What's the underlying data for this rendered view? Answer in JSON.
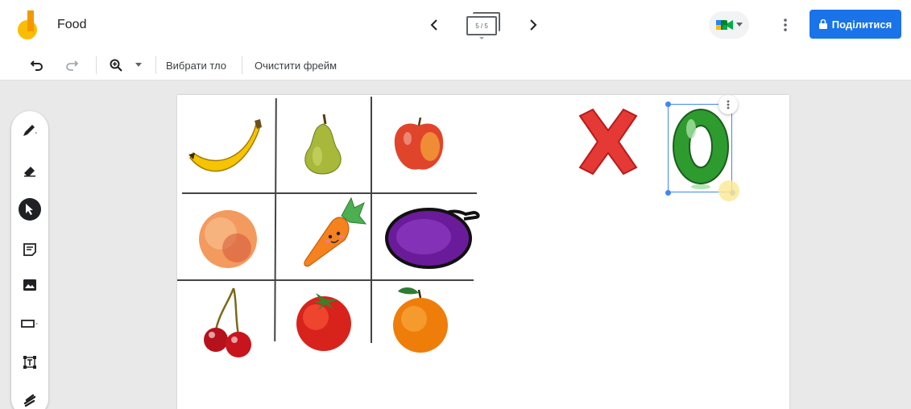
{
  "header": {
    "title": "Food",
    "frame_counter": "5 / 5",
    "share_label": "Поділитися",
    "icons": {
      "logo": "jamboard-logo-icon",
      "prev": "chevron-left-icon",
      "next": "chevron-right-icon",
      "meet": "google-meet-icon",
      "more": "more-vert-icon",
      "lock": "lock-icon"
    }
  },
  "toolbar": {
    "set_background_label": "Вибрати тло",
    "clear_frame_label": "Очистити фрейм",
    "icons": [
      "undo-icon",
      "redo-icon",
      "zoom-icon",
      "dropdown-icon"
    ]
  },
  "tools": [
    "pen-icon",
    "eraser-icon",
    "select-icon",
    "sticky-note-icon",
    "image-icon",
    "shape-icon",
    "text-box-icon",
    "laser-icon"
  ],
  "colors": {
    "accent": "#1a73e8",
    "grid": "#444444",
    "x_mark": "#e53935",
    "o_mark": "#2e9b2e"
  },
  "board": {
    "cells": [
      "banana",
      "pear",
      "apple",
      "peach",
      "carrot",
      "plum",
      "cherries",
      "tomato",
      "orange"
    ],
    "marks": [
      "x-mark",
      "o-mark"
    ]
  }
}
